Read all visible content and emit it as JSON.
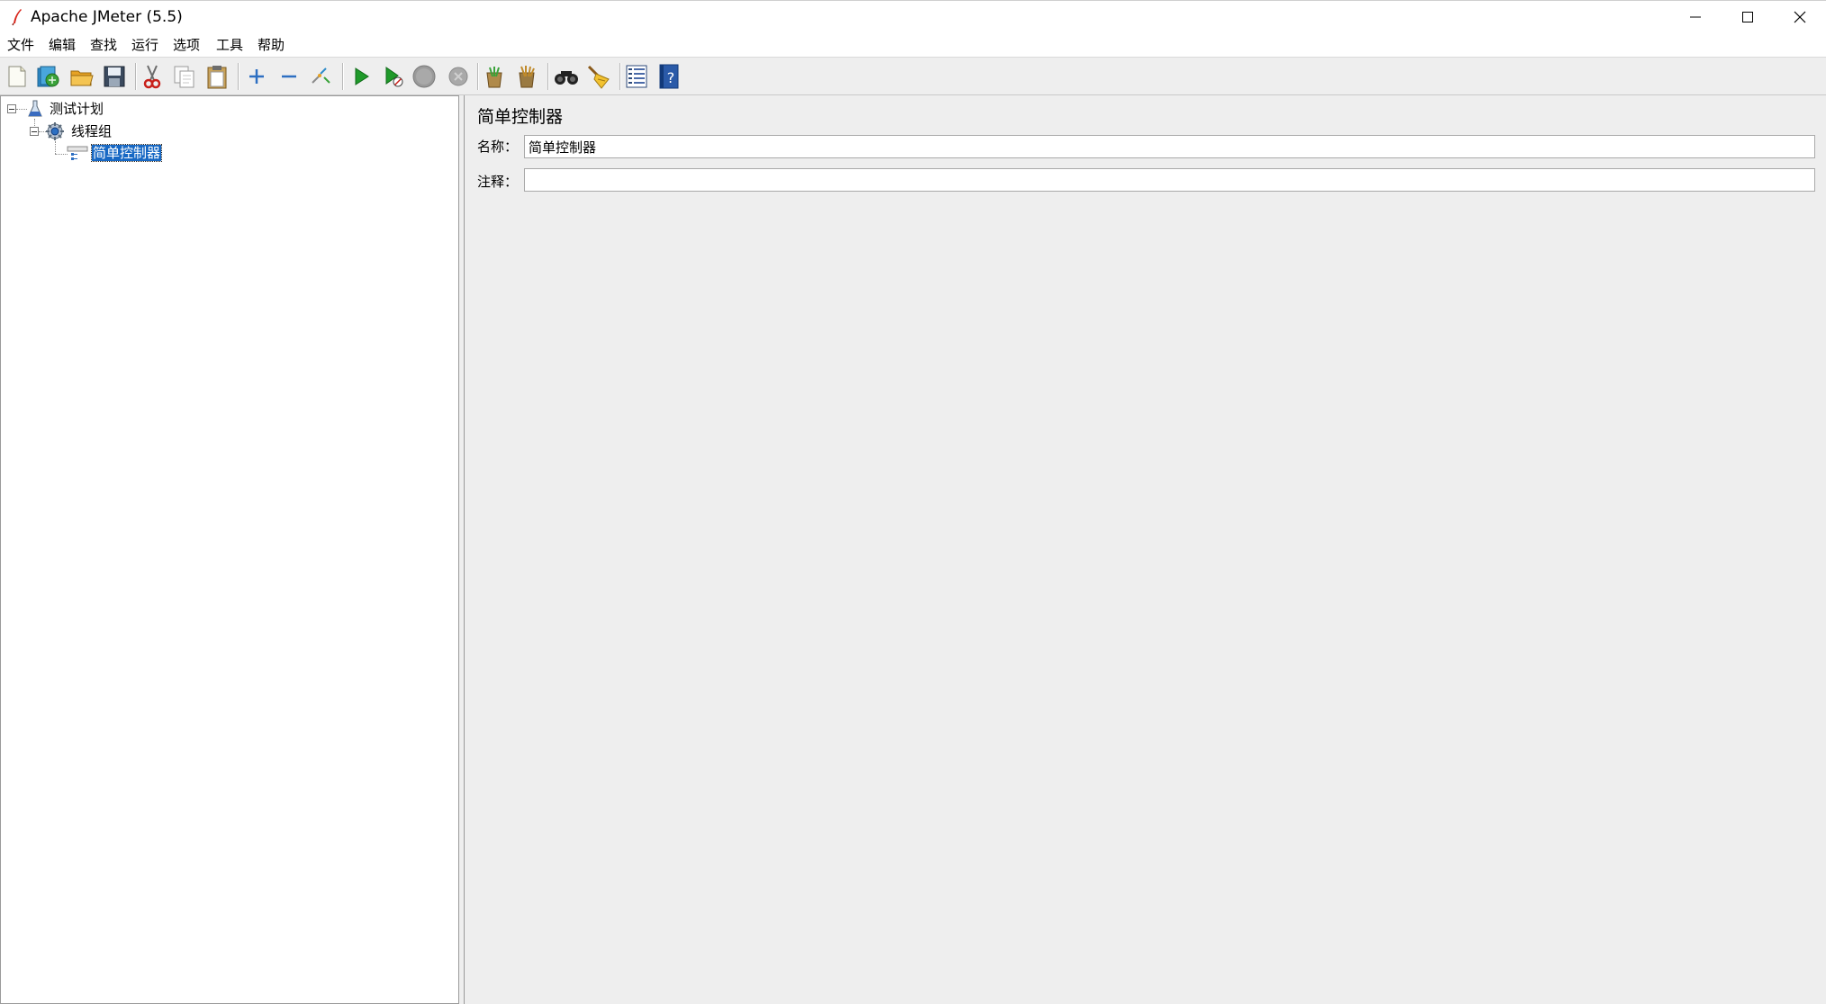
{
  "window": {
    "title": "Apache JMeter (5.5)",
    "icon": "jmeter-feather-icon",
    "controls": [
      "minimize-icon",
      "maximize-icon",
      "close-icon"
    ]
  },
  "menu": {
    "items": [
      "文件",
      "编辑",
      "查找",
      "运行",
      "选项",
      "工具",
      "帮助"
    ]
  },
  "toolbar": {
    "buttons": [
      "new-icon",
      "templates-icon",
      "open-icon",
      "save-icon",
      "cut-icon",
      "copy-icon",
      "paste-icon",
      "expand-icon",
      "collapse-icon",
      "toggle-icon",
      "start-icon",
      "start-no-pauses-icon",
      "stop-icon",
      "shutdown-icon",
      "clear-icon",
      "clear-all-icon",
      "search-icon",
      "reset-search-icon",
      "function-helper-icon",
      "help-icon"
    ]
  },
  "tree": {
    "root": {
      "label": "测试计划",
      "icon": "test-plan-flask-icon"
    },
    "thread_group": {
      "label": "线程组",
      "icon": "thread-group-gear-icon"
    },
    "controller": {
      "label": "简单控制器",
      "icon": "simple-controller-icon",
      "selected": true
    }
  },
  "panel": {
    "title": "简单控制器",
    "name_label": "名称：",
    "name_value": "简单控制器",
    "comment_label": "注释：",
    "comment_value": ""
  },
  "colors": {
    "selection": "#1768c4",
    "background": "#eeeeee"
  }
}
